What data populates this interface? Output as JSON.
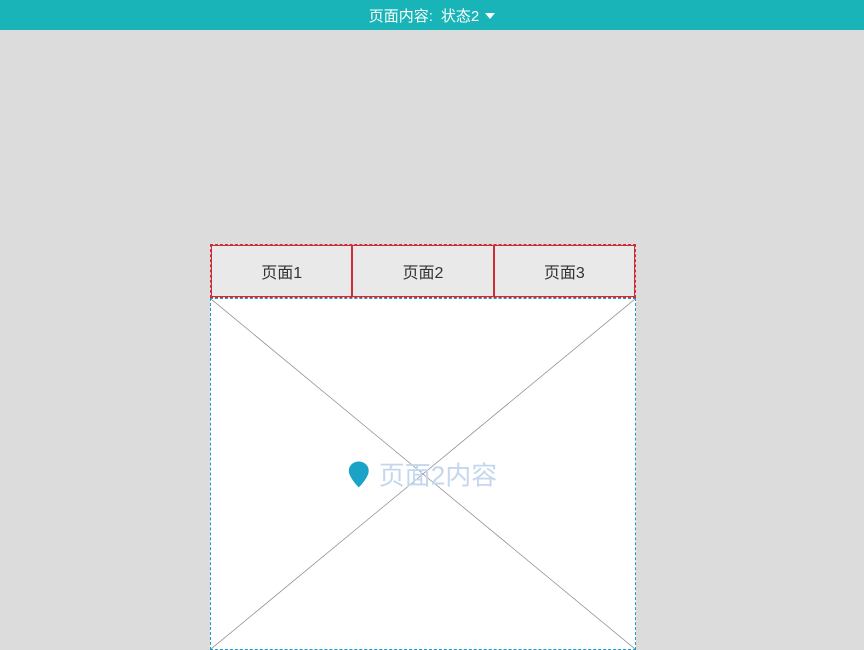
{
  "header": {
    "label": "页面内容",
    "stateValue": "状态2"
  },
  "tabs": [
    {
      "label": "页面1"
    },
    {
      "label": "页面2"
    },
    {
      "label": "页面3"
    }
  ],
  "content": {
    "text": "页面2内容"
  }
}
